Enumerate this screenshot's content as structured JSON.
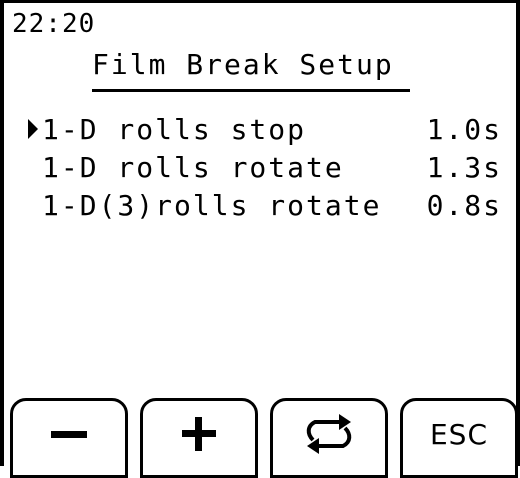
{
  "status": {
    "time": "22:20"
  },
  "screen": {
    "title": "Film Break Setup"
  },
  "menu": {
    "items": [
      {
        "label": "1-D rolls stop",
        "value": "1.0s",
        "selected": true
      },
      {
        "label": "1-D rolls rotate",
        "value": "1.3s",
        "selected": false
      },
      {
        "label": "1-D(3)rolls rotate",
        "value": "0.8s",
        "selected": false
      }
    ]
  },
  "softkeys": {
    "minus": {
      "icon": "minus-icon"
    },
    "plus": {
      "icon": "plus-icon"
    },
    "swap": {
      "icon": "swap-arrows-icon"
    },
    "esc": {
      "label": "ESC"
    }
  },
  "colors": {
    "background": "#ffffff",
    "foreground": "#000000"
  }
}
